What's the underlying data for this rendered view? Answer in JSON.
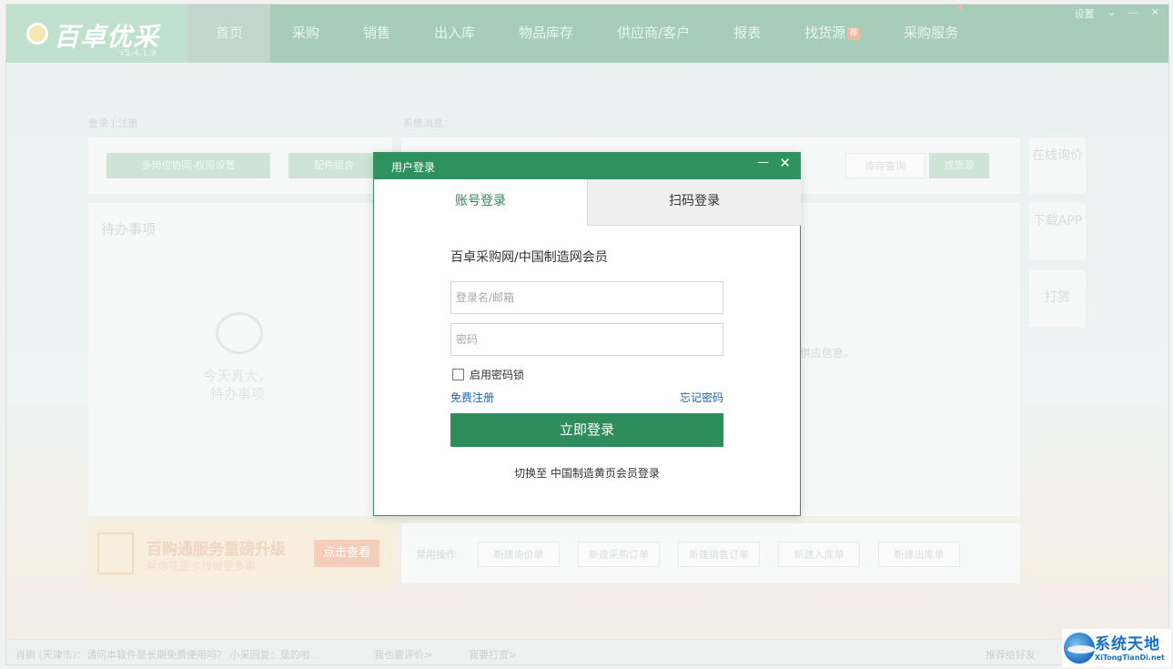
{
  "app": {
    "logo": "百卓优采",
    "version": "v5.4.1.9",
    "nav": [
      "首页",
      "采购",
      "销售",
      "出入库",
      "物品库存",
      "供应商/客户",
      "报表",
      "找货源",
      "采购服务"
    ],
    "nav_hot_badge": "荐",
    "window_controls": [
      "设置",
      "⌄",
      "—",
      "✕"
    ],
    "left_tabs": {
      "login": "登录",
      "sep": "|",
      "register": "注册"
    },
    "system_msg_label": "系统消息：",
    "quick_buttons": [
      "多岗位协同-权限设置",
      "配件组合"
    ],
    "search_buttons": [
      "库存查询",
      "找货源"
    ],
    "todo_title": "待办事项",
    "todo_empty": "今天真大，待办事项",
    "supplier_tip": "供应信息。",
    "side_cards": [
      "在线询价",
      "下载APP",
      "打赏"
    ],
    "promo": {
      "title": "百购通服务重磅升级",
      "subtitle": "帮你花更少钱做更多事",
      "button": "点击查看"
    },
    "ops": {
      "label": "常用操作",
      "buttons": [
        "新建询价单",
        "新建采购订单",
        "新建销售订单",
        "新建入库单",
        "新建出库单"
      ]
    },
    "statusbar": {
      "message": "肖鹏 (天津市)：请问本软件是长期免费使用吗？ 小采回复：是的啦...",
      "review": "我也要评价>",
      "reward": "我要打赏>",
      "share": "推荐给好友"
    }
  },
  "dialog": {
    "title": "用户登录",
    "minimize": "—",
    "close": "✕",
    "tabs": [
      "账号登录",
      "扫码登录"
    ],
    "member_label": "百卓采购网/中国制造网会员",
    "username_placeholder": "登录名/邮箱",
    "password_placeholder": "密码",
    "remember_label": "启用密码锁",
    "register_link": "免费注册",
    "forgot_link": "忘记密码",
    "login_button": "立即登录",
    "switch_text": "切换至 中国制造黄页会员登录"
  },
  "watermark": {
    "title": "系统天地",
    "subtitle": "XiTongTianDi.net"
  }
}
